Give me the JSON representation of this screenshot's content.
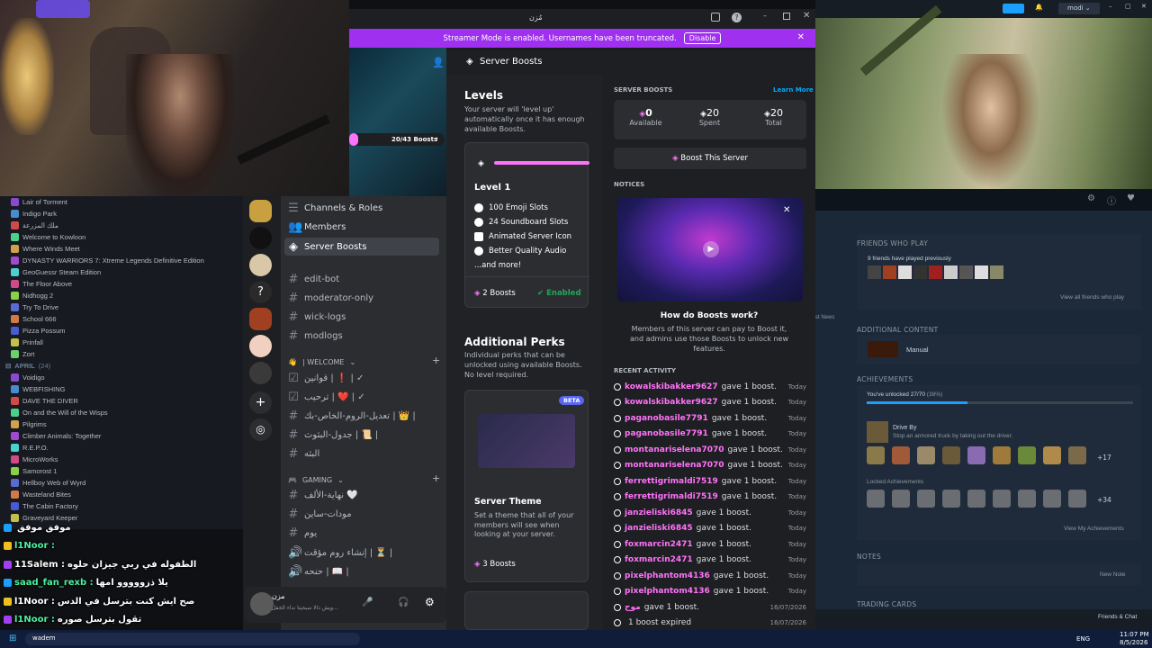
{
  "discord": {
    "title_glyph": "مُزن",
    "streamer_banner": "Streamer Mode is enabled. Usernames have been truncated.",
    "disable_label": "Disable",
    "boosts_pill": "20/43 Boosts",
    "settings_title": "Server Boosts",
    "settings_nav": [
      "Channels & Roles",
      "Members",
      "Server Boosts"
    ],
    "channels": [
      "edit-bot",
      "moderator-only",
      "wick-logs",
      "modlogs"
    ],
    "welcome_category": "| WELCOME",
    "welcome_channels": [
      "قوانين | ❗ | ✓",
      "ترحيب | ❤️ | ✓",
      "تعديل-الروم-الخاص-بك | 👑 |",
      "جدول-البثوث | 📜 |",
      "البثه"
    ],
    "gaming_category": "GAMING",
    "gaming_channels": [
      "نهاية-الألف 🤍",
      "مودات-ساين",
      "يوم",
      "إنشاء روم مؤقت | ⏳ |",
      "حنحه | 📖 |"
    ],
    "user_panel_name": "مزن",
    "user_panel_status": "ويش ذالا سبحيتا نداء الخفل...",
    "levels": {
      "heading": "Levels",
      "desc": "Your server will 'level up' automatically once it has enough available Boosts.",
      "level_title": "Level 1",
      "perks": [
        "100 Emoji Slots",
        "24 Soundboard Slots",
        "Animated Server Icon",
        "Better Quality Audio"
      ],
      "more": "...and more!",
      "boosts": "2 Boosts",
      "status": "Enabled"
    },
    "additional": {
      "heading": "Additional Perks",
      "desc": "Individual perks that can be unlocked using available Boosts. No level required.",
      "badge": "BETA",
      "theme_title": "Server Theme",
      "theme_desc": "Set a theme that all of your members will see when looking at your server.",
      "theme_boosts": "3 Boosts"
    },
    "server_boosts": {
      "heading": "SERVER BOOSTS",
      "learn_more": "Learn More",
      "stats": [
        {
          "value": "0",
          "label": "Available"
        },
        {
          "value": "20",
          "label": "Spent"
        },
        {
          "value": "20",
          "label": "Total"
        }
      ],
      "boost_button": "Boost This Server"
    },
    "notices": {
      "heading": "NOTICES",
      "title": "How do Boosts work?",
      "desc": "Members of this server can pay to Boost it, and admins use those Boosts to unlock new features."
    },
    "recent": {
      "heading": "RECENT ACTIVITY",
      "items": [
        {
          "user": "kowalskibakker9627",
          "action": "gave 1 boost.",
          "time": "Today"
        },
        {
          "user": "kowalskibakker9627",
          "action": "gave 1 boost.",
          "time": "Today"
        },
        {
          "user": "paganobasile7791",
          "action": "gave 1 boost.",
          "time": "Today"
        },
        {
          "user": "paganobasile7791",
          "action": "gave 1 boost.",
          "time": "Today"
        },
        {
          "user": "montanariselena7070",
          "action": "gave 1 boost.",
          "time": "Today"
        },
        {
          "user": "montanariselena7070",
          "action": "gave 1 boost.",
          "time": "Today"
        },
        {
          "user": "ferrettigrimaldi7519",
          "action": "gave 1 boost.",
          "time": "Today"
        },
        {
          "user": "ferrettigrimaldi7519",
          "action": "gave 1 boost.",
          "time": "Today"
        },
        {
          "user": "janzieliski6845",
          "action": "gave 1 boost.",
          "time": "Today"
        },
        {
          "user": "janzieliski6845",
          "action": "gave 1 boost.",
          "time": "Today"
        },
        {
          "user": "foxmarcin2471",
          "action": "gave 1 boost.",
          "time": "Today"
        },
        {
          "user": "foxmarcin2471",
          "action": "gave 1 boost.",
          "time": "Today"
        },
        {
          "user": "pixelphantom4136",
          "action": "gave 1 boost.",
          "time": "Today"
        },
        {
          "user": "pixelphantom4136",
          "action": "gave 1 boost.",
          "time": "Today"
        },
        {
          "user": "موح",
          "action": "gave 1 boost.",
          "time": "16/07/2026"
        },
        {
          "user": "",
          "action": "1 boost expired",
          "time": "16/07/2026"
        }
      ]
    }
  },
  "steam_list": {
    "items_top": [
      "Lair of Torment",
      "Indigo Park",
      "ملك المزرعة",
      "Welcome to Kowloon",
      "Where Winds Meet",
      "DYNASTY WARRIORS 7: Xtreme Legends Definitive Edition",
      "GeoGuessr Steam Edition",
      "The Floor Above",
      "Nidhogg 2",
      "Try To Drive",
      "School 666",
      "Pizza Possum",
      "Prinfall",
      "Zort"
    ],
    "section": "APRIL",
    "section_count": "(24)",
    "items_bottom": [
      "Voidigo",
      "WEBFISHING",
      "DAVE THE DIVER",
      "On and the Will of the Wisps",
      "Pilgrims",
      "Climber Animals: Together",
      "R.E.P.O.",
      "MicroWorks",
      "Samorost 1",
      "Hellboy Web of Wyrd",
      "Wasteland Bites",
      "The Cabin Factory",
      "Graveyard Keeper"
    ]
  },
  "chat": [
    {
      "user": "",
      "msg": "موفق موفق"
    },
    {
      "user": "l1Noor :",
      "msg": ""
    },
    {
      "user": "11Salem :",
      "msg": "الطفوله في ربي جيزان حلوه"
    },
    {
      "user": "saad_fan_rexb :",
      "msg": "يلا ذزووووو امها"
    },
    {
      "user": "l1Noor :",
      "msg": "صح ايش كنت بترسل في الدس"
    },
    {
      "user": "l1Noor :",
      "msg": "تقول بترسل صوره"
    }
  ],
  "steam_right": {
    "friends_heading": "FRIENDS WHO PLAY",
    "friends_played": "9 friends have played previously",
    "view_friends": "View all friends who play",
    "additional_heading": "ADDITIONAL CONTENT",
    "manual": "Manual",
    "achievements_heading": "ACHIEVEMENTS",
    "unlocked": "You've unlocked 27/70",
    "unlocked_pct": "(38%)",
    "progress": 0.38,
    "ach_name": "Drive By",
    "ach_desc": "Stop an armored truck by taking out the driver.",
    "more_unlocked": "+17",
    "locked_heading": "Locked Achievements",
    "more_locked": "+34",
    "view_ach": "View My Achievements",
    "notes_heading": "NOTES",
    "new_note": "New Note",
    "trading_heading": "TRADING CARDS",
    "news": "st News",
    "friends_chat": "Friends & Chat",
    "username": "modi"
  },
  "taskbar": {
    "lang": "ENG",
    "time": "11:07 PM",
    "date": "8/5/2026",
    "search_user": "wadem"
  },
  "colors": {
    "accent_pink": "#ff73fa",
    "banner": "#a030f0",
    "discord_bg": "#1e1f22",
    "steam_bg": "#1b2838",
    "enabled": "#23a55a"
  }
}
